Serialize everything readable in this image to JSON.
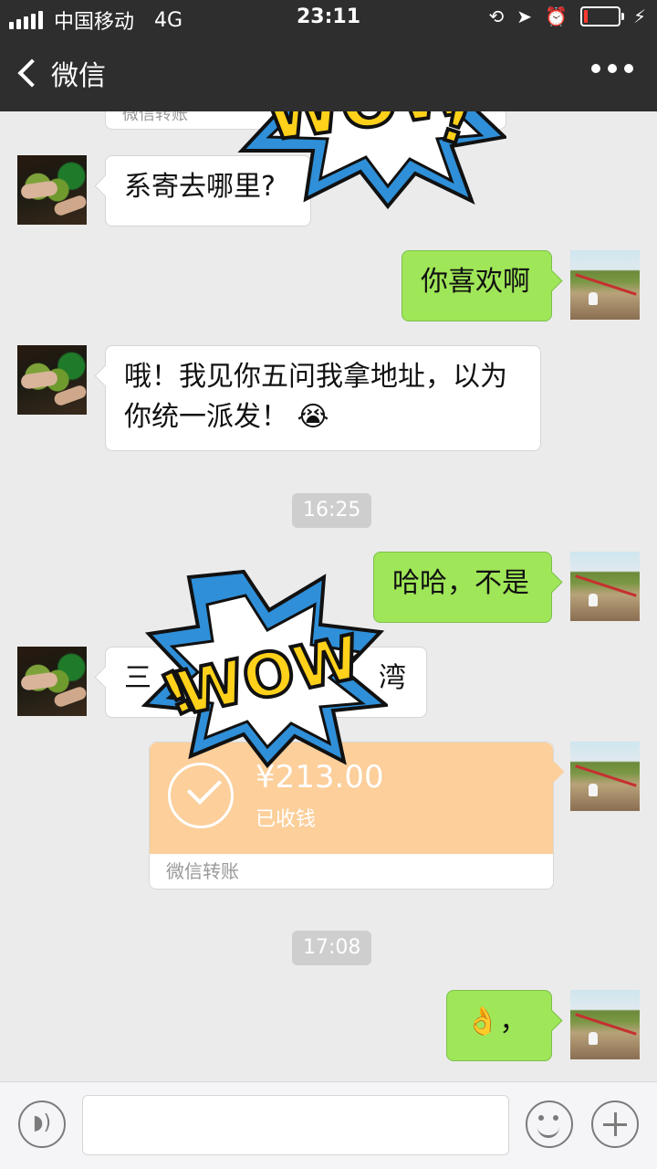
{
  "status_bar": {
    "carrier": "中国移动",
    "network": "4G",
    "time": "23:11",
    "battery_level": 0.12
  },
  "nav": {
    "back_label": "微信"
  },
  "partial_card_label": "微信转账",
  "messages": [
    {
      "side": "in",
      "text": "系寄去哪里?"
    },
    {
      "side": "out",
      "text": "你喜欢啊"
    },
    {
      "side": "in",
      "text": "哦！我见你五问我拿地址，以为你统一派发！",
      "emoji": "😭"
    },
    {
      "type": "time",
      "text": "16:25"
    },
    {
      "side": "out",
      "text": "哈哈，不是"
    },
    {
      "side": "in",
      "text_start": "三",
      "text_end": "湾"
    },
    {
      "type": "transfer",
      "amount": "¥213.00",
      "status": "已收钱",
      "label": "微信转账"
    },
    {
      "type": "time",
      "text": "17:08"
    },
    {
      "side": "out",
      "emoji": "👌",
      "text": "，"
    }
  ],
  "stickers": [
    "WOW",
    "WOW"
  ],
  "input": {
    "value": ""
  }
}
